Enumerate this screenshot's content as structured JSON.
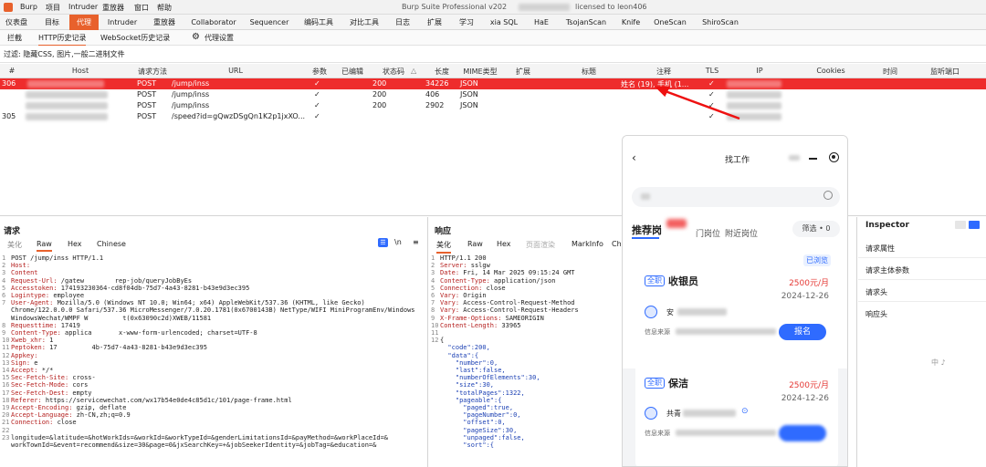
{
  "window": {
    "title": "Burp Suite Professional v202",
    "license": "licensed to leon406"
  },
  "menu": [
    "Burp",
    "项目",
    "Intruder",
    "重放器",
    "窗口",
    "帮助"
  ],
  "tabs": [
    "仪表盘",
    "目标",
    "代理",
    "Intruder",
    "重放器",
    "Collaborator",
    "Sequencer",
    "编码工具",
    "对比工具",
    "日志",
    "扩展",
    "学习",
    "xia SQL",
    "HaE",
    "TsojanScan",
    "Knife",
    "OneScan",
    "ShiroScan"
  ],
  "active_tab": "代理",
  "subtabs": [
    "拦截",
    "HTTP历史记录",
    "WebSocket历史记录",
    "代理设置"
  ],
  "filter_text": "过滤: 隐藏CSS, 图片,一般二进制文件",
  "table": {
    "headers": [
      "#",
      "Host",
      "请求方法",
      "URL",
      "参数",
      "已编辑",
      "状态码",
      "长度",
      "MIME类型",
      "扩展",
      "标题",
      "注释",
      "TLS",
      "IP",
      "Cookies",
      "时间",
      "监听端口"
    ],
    "rows": [
      {
        "id": "306",
        "method": "POST",
        "url": "/jump/inss",
        "params": "✓",
        "status": "200",
        "length": "34226",
        "mime": "JSON",
        "comment": "姓名 (19), 手机 (1...",
        "tls": "✓",
        "selected": true
      },
      {
        "id": "",
        "method": "POST",
        "url": "/jump/inss",
        "params": "✓",
        "status": "200",
        "length": "406",
        "mime": "JSON",
        "comment": "",
        "tls": "✓",
        "selected": false
      },
      {
        "id": "",
        "method": "POST",
        "url": "/jump/inss",
        "params": "✓",
        "status": "200",
        "length": "2902",
        "mime": "JSON",
        "comment": "",
        "tls": "✓",
        "selected": false
      },
      {
        "id": "305",
        "method": "POST",
        "url": "/speed?id=gQwzDSgQn1K2p1jxXO...",
        "params": "✓",
        "status": "",
        "length": "",
        "mime": "",
        "comment": "",
        "tls": "✓",
        "selected": false
      }
    ]
  },
  "request": {
    "title": "请求",
    "tabs": [
      "美化",
      "Raw",
      "Hex",
      "Chinese"
    ],
    "active_tab": "Raw",
    "lines": [
      {
        "n": "1",
        "k": "",
        "v": "POST /jump/inss HTTP/1.1"
      },
      {
        "n": "2",
        "k": "Host:",
        "v": ""
      },
      {
        "n": "3",
        "k": "Content",
        "v": ""
      },
      {
        "n": "4",
        "k": "Request-Url:",
        "v": " /gatew        rep-job/queryJobByEs"
      },
      {
        "n": "5",
        "k": "Accesstoken:",
        "v": " 174193230364-cd8f04db-75d7-4a43-8281-b43e9d3ec395"
      },
      {
        "n": "6",
        "k": "Logintype:",
        "v": " employee"
      },
      {
        "n": "7",
        "k": "User-Agent:",
        "v": " Mozilla/5.0 (Windows NT 10.0; Win64; x64) AppleWebKit/537.36 (KHTML, like Gecko)"
      },
      {
        "n": "",
        "k": "",
        "v": "Chrome/122.0.0.0 Safari/537.36 MicroMessenger/7.0.20.1781(0x6700143B) NetType/WIFI MiniProgramEnv/Windows"
      },
      {
        "n": "",
        "k": "",
        "v": "WindowsWechat/WMPF W         t(0x63090c2d)XWEB/11581"
      },
      {
        "n": "8",
        "k": "Requesttime:",
        "v": " 17419"
      },
      {
        "n": "9",
        "k": "Content-Type:",
        "v": " applica       x-www-form-urlencoded; charset=UTF-8"
      },
      {
        "n": "10",
        "k": "Xweb_xhr:",
        "v": " 1"
      },
      {
        "n": "11",
        "k": "Peptoken:",
        "v": " 17         4b-75d7-4a43-8281-b43e9d3ec395"
      },
      {
        "n": "12",
        "k": "Appkey:",
        "v": ""
      },
      {
        "n": "13",
        "k": "Sign:",
        "v": " e"
      },
      {
        "n": "14",
        "k": "Accept:",
        "v": " */*"
      },
      {
        "n": "15",
        "k": "Sec-Fetch-Site:",
        "v": " cross-"
      },
      {
        "n": "16",
        "k": "Sec-Fetch-Mode:",
        "v": " cors"
      },
      {
        "n": "17",
        "k": "Sec-Fetch-Dest:",
        "v": " empty"
      },
      {
        "n": "18",
        "k": "Referer:",
        "v": " https://servicewechat.com/wx17b54e0de4c85d1c/101/page-frame.html"
      },
      {
        "n": "19",
        "k": "Accept-Encoding:",
        "v": " gzip, deflate"
      },
      {
        "n": "20",
        "k": "Accept-Language:",
        "v": " zh-CN,zh;q=0.9"
      },
      {
        "n": "21",
        "k": "Connection:",
        "v": " close"
      },
      {
        "n": "22",
        "k": "",
        "v": ""
      },
      {
        "n": "23",
        "k": "",
        "v": "longitude=&latitude=&hotWorkIds=&workId=&workTypeId=&genderLimitationsId=&payMethod=&workPlaceId=&"
      },
      {
        "n": "",
        "k": "",
        "v": "workTownId=&event=recommend&size=30&page=0&jxSearchKey=+&jobSeekerIdentity=&jobTag=&education=&"
      }
    ]
  },
  "response": {
    "title": "响应",
    "tabs": [
      "美化",
      "Raw",
      "Hex",
      "页面渲染",
      "MarkInfo",
      "Chi"
    ],
    "active_tab": "美化",
    "lines": [
      {
        "n": "1",
        "k": "",
        "v": "HTTP/1.1 200"
      },
      {
        "n": "2",
        "k": "Server:",
        "v": " sslgw"
      },
      {
        "n": "3",
        "k": "Date:",
        "v": " Fri, 14 Mar 2025 09:15:24 GMT"
      },
      {
        "n": "4",
        "k": "Content-Type:",
        "v": " application/json"
      },
      {
        "n": "5",
        "k": "Connection:",
        "v": " close"
      },
      {
        "n": "6",
        "k": "Vary:",
        "v": " Origin"
      },
      {
        "n": "7",
        "k": "Vary:",
        "v": " Access-Control-Request-Method"
      },
      {
        "n": "8",
        "k": "Vary:",
        "v": " Access-Control-Request-Headers"
      },
      {
        "n": "9",
        "k": "X-Frame-Options:",
        "v": " SAMEORIGIN"
      },
      {
        "n": "10",
        "k": "Content-Length:",
        "v": " 33965"
      },
      {
        "n": "11",
        "k": "",
        "v": ""
      },
      {
        "n": "12",
        "k": "",
        "v": "{"
      },
      {
        "n": "",
        "k": "",
        "v": "  \"code\":200,"
      },
      {
        "n": "",
        "k": "",
        "v": "  \"data\":{"
      },
      {
        "n": "",
        "k": "",
        "v": "    \"number\":0,"
      },
      {
        "n": "",
        "k": "",
        "v": "    \"last\":false,"
      },
      {
        "n": "",
        "k": "",
        "v": "    \"numberOfElements\":30,"
      },
      {
        "n": "",
        "k": "",
        "v": "    \"size\":30,"
      },
      {
        "n": "",
        "k": "",
        "v": "    \"totalPages\":1322,"
      },
      {
        "n": "",
        "k": "",
        "v": "    \"pageable\":{"
      },
      {
        "n": "",
        "k": "",
        "v": "      \"paged\":true,"
      },
      {
        "n": "",
        "k": "",
        "v": "      \"pageNumber\":0,"
      },
      {
        "n": "",
        "k": "",
        "v": "      \"offset\":0,"
      },
      {
        "n": "",
        "k": "",
        "v": "      \"pageSize\":30,"
      },
      {
        "n": "",
        "k": "",
        "v": "      \"unpaged\":false,"
      },
      {
        "n": "",
        "k": "",
        "v": "      \"sort\":{"
      }
    ]
  },
  "phone": {
    "title": "找工作",
    "tab_recommend": "推荐岗",
    "tab_hot": "门岗位",
    "tab_near": "附近岗位",
    "filter": "筛选 • 0",
    "cards": [
      {
        "badge": "全职",
        "title": "收银员",
        "salary": "2500元/月",
        "date": "2024-12-26",
        "location": "安",
        "source": "信息来源",
        "apply": "报名",
        "status": "已浏览"
      },
      {
        "badge": "全职",
        "title": "保洁",
        "salary": "2500元/月",
        "date": "2024-12-26",
        "location": "共青",
        "source": "信息来源",
        "apply": "",
        "status": ""
      }
    ]
  },
  "inspector": {
    "title": "Inspector",
    "items": [
      "请求属性",
      "请求主体参数",
      "请求头",
      "响应头"
    ],
    "ime": "中 ♪ "
  },
  "colors": {
    "accent": "#e8612c",
    "selection": "#ee2c2c",
    "phone_blue": "#2f6bff",
    "salary_red": "#e53935"
  }
}
